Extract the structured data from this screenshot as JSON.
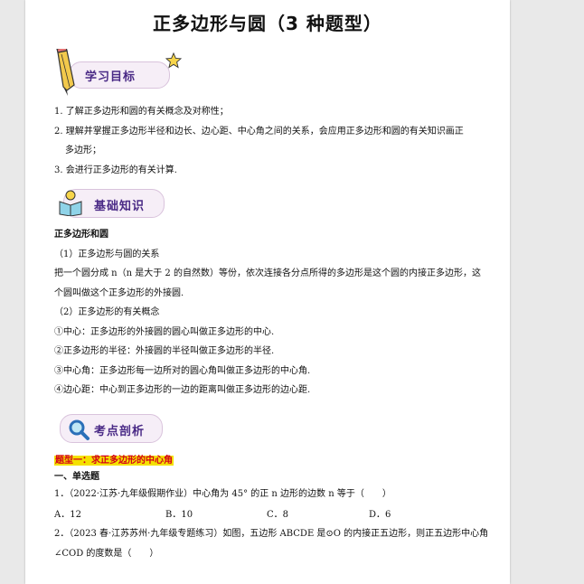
{
  "title": "正多边形与圆（3 种题型）",
  "banners": {
    "goals": "学习目标",
    "basics": "基础知识",
    "analysis": "考点剖析"
  },
  "goals": [
    "1. 了解正多边形和圆的有关概念及对称性；",
    "2. 理解并掌握正多边形半径和边长、边心距、中心角之间的关系，会应用正多边形和圆的有关知识画正",
    "多边形；",
    "3. 会进行正多边形的有关计算."
  ],
  "basics": {
    "heading": "正多边形和圆",
    "lines": [
      "（1）正多边形与圆的关系",
      "把一个圆分成 n（n 是大于 2 的自然数）等份，依次连接各分点所得的多边形是这个圆的内接正多边形，这",
      "个圆叫做这个正多边形的外接圆.",
      "（2）正多边形的有关概念",
      "①中心：正多边形的外接圆的圆心叫做正多边形的中心.",
      "②正多边形的半径：外接圆的半径叫做正多边形的半径.",
      "③中心角：正多边形每一边所对的圆心角叫做正多边形的中心角.",
      "④边心距：中心到正多边形的一边的距离叫做正多边形的边心距."
    ]
  },
  "section": {
    "type_heading": "题型一：求正多边形的中心角",
    "sub_heading": "一、单选题",
    "q1": "1．（2022·江苏·九年级假期作业）中心角为 45° 的正 n 边形的边数 n 等于（　　）",
    "q1_options": [
      "A．12",
      "B．10",
      "C．8",
      "D．6"
    ],
    "q2_line1": "2．（2023 春·江苏苏州·九年级专题练习）如图，五边形 ABCDE 是⊙O 的内接正五边形，则正五边形中心角",
    "q2_line2": "∠COD 的度数是（　　）"
  }
}
